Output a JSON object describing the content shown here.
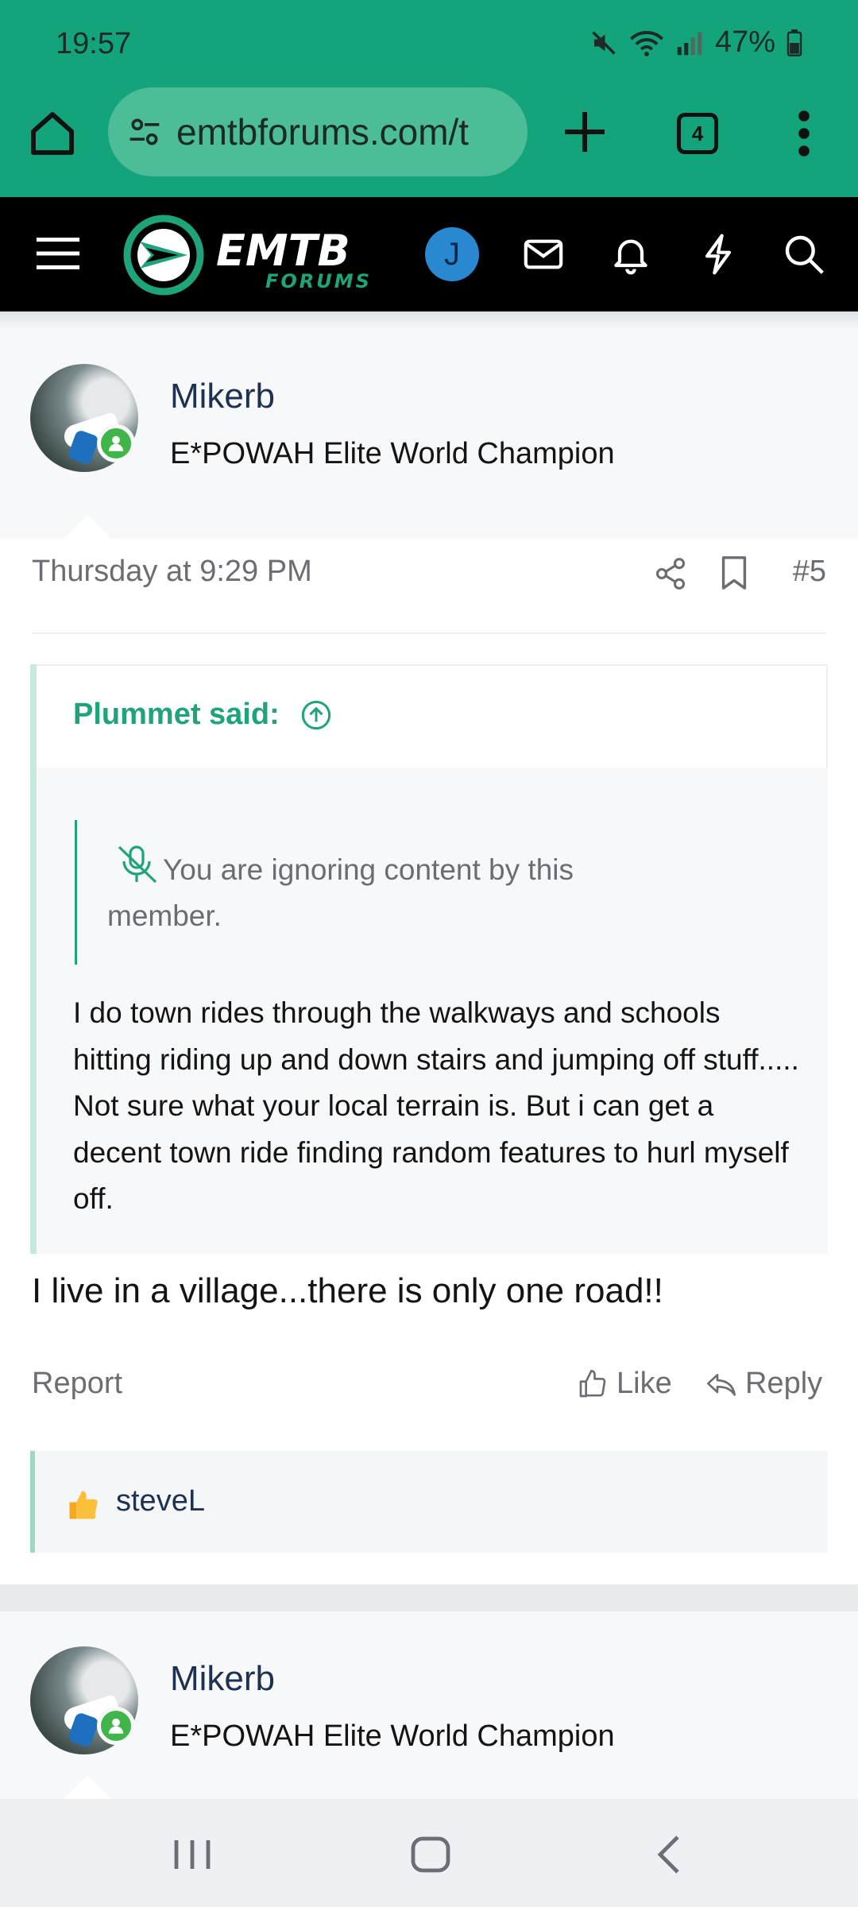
{
  "status_bar": {
    "time": "19:57",
    "battery": "47%"
  },
  "browser": {
    "url": "emtbforums.com/t",
    "tab_count": "4"
  },
  "site": {
    "logo_main": "EMTB",
    "logo_sub": "FORUMS",
    "user_initial": "J"
  },
  "post": {
    "author": "Mikerb",
    "author_title": "E*POWAH Elite World Champion",
    "date": "Thursday at 9:29 PM",
    "number": "#5",
    "quote": {
      "author_label": "Plummet said:",
      "ignored_notice": "You are ignoring content by this member.",
      "text": "I do town rides through the walkways and schools hitting riding up and down stairs and jumping off stuff..... Not sure what your local terrain is. But i can get a decent town ride finding random features to hurl myself off."
    },
    "body": "I live in a village...there is only one road!!",
    "actions": {
      "report": "Report",
      "like": "Like",
      "reply": "Reply"
    },
    "reactions": {
      "user": "steveL"
    }
  },
  "next_post": {
    "author": "Mikerb",
    "author_title": "E*POWAH Elite World Champion"
  },
  "colors": {
    "brand_green": "#14a47c",
    "accent": "#1ea37a",
    "header_bg": "#000000",
    "avatar_blue": "#2a88d1",
    "online": "#3fb54a"
  }
}
